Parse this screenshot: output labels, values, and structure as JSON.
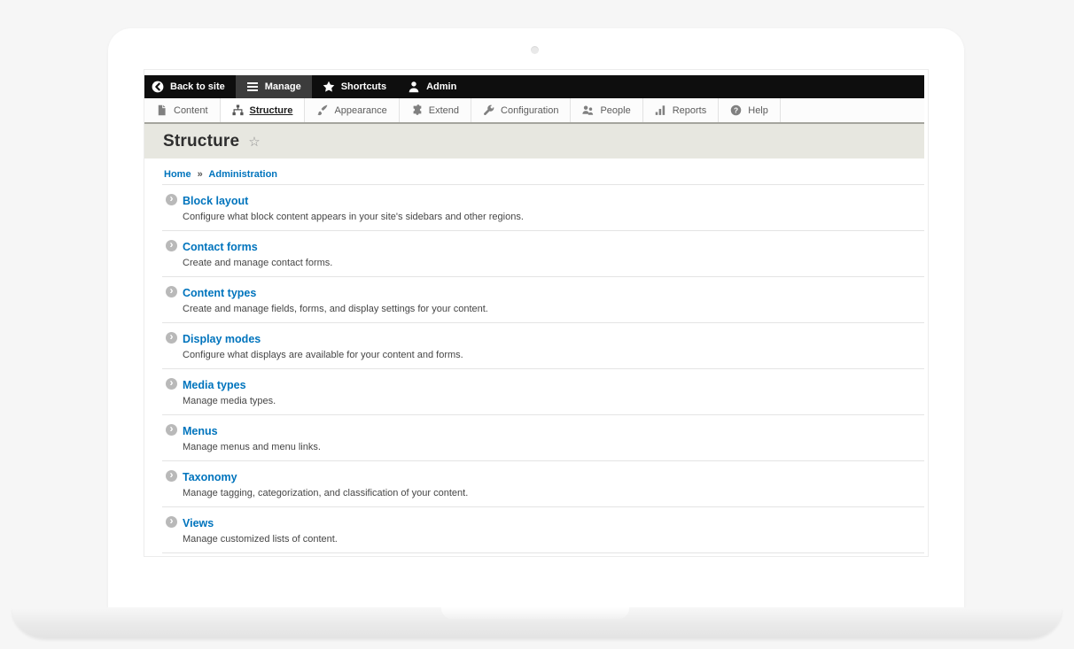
{
  "admin_toolbar": {
    "items": [
      {
        "label": "Back to site",
        "icon": "back-arrow-icon"
      },
      {
        "label": "Manage",
        "icon": "hamburger-icon",
        "active": true
      },
      {
        "label": "Shortcuts",
        "icon": "star-icon"
      },
      {
        "label": "Admin",
        "icon": "user-icon"
      }
    ]
  },
  "tabs": [
    {
      "label": "Content",
      "icon": "document-icon"
    },
    {
      "label": "Structure",
      "icon": "sitemap-icon",
      "active": true
    },
    {
      "label": "Appearance",
      "icon": "paintbrush-icon"
    },
    {
      "label": "Extend",
      "icon": "puzzle-icon"
    },
    {
      "label": "Configuration",
      "icon": "wrench-icon"
    },
    {
      "label": "People",
      "icon": "people-icon"
    },
    {
      "label": "Reports",
      "icon": "bar-chart-icon"
    },
    {
      "label": "Help",
      "icon": "question-icon"
    }
  ],
  "page": {
    "title": "Structure",
    "breadcrumb": {
      "items": [
        {
          "label": "Home"
        },
        {
          "label": "Administration"
        }
      ],
      "separator": "»"
    }
  },
  "icons": {
    "star_outline": "☆",
    "circled_chevron": "›"
  },
  "structure_items": [
    {
      "title": "Block layout",
      "description": "Configure what block content appears in your site's sidebars and other regions."
    },
    {
      "title": "Contact forms",
      "description": "Create and manage contact forms."
    },
    {
      "title": "Content types",
      "description": "Create and manage fields, forms, and display settings for your content."
    },
    {
      "title": "Display modes",
      "description": "Configure what displays are available for your content and forms."
    },
    {
      "title": "Media types",
      "description": "Manage media types."
    },
    {
      "title": "Menus",
      "description": "Manage menus and menu links."
    },
    {
      "title": "Taxonomy",
      "description": "Manage tagging, categorization, and classification of your content."
    },
    {
      "title": "Views",
      "description": "Manage customized lists of content."
    }
  ],
  "colors": {
    "link_blue": "#0074bd",
    "toolbar_black": "#0e0e0e",
    "toolbar_active": "#3c3c3c",
    "title_band_beige": "#e7e7e0",
    "title_band_border": "#a5a59e",
    "divider": "#e4e4e4"
  }
}
